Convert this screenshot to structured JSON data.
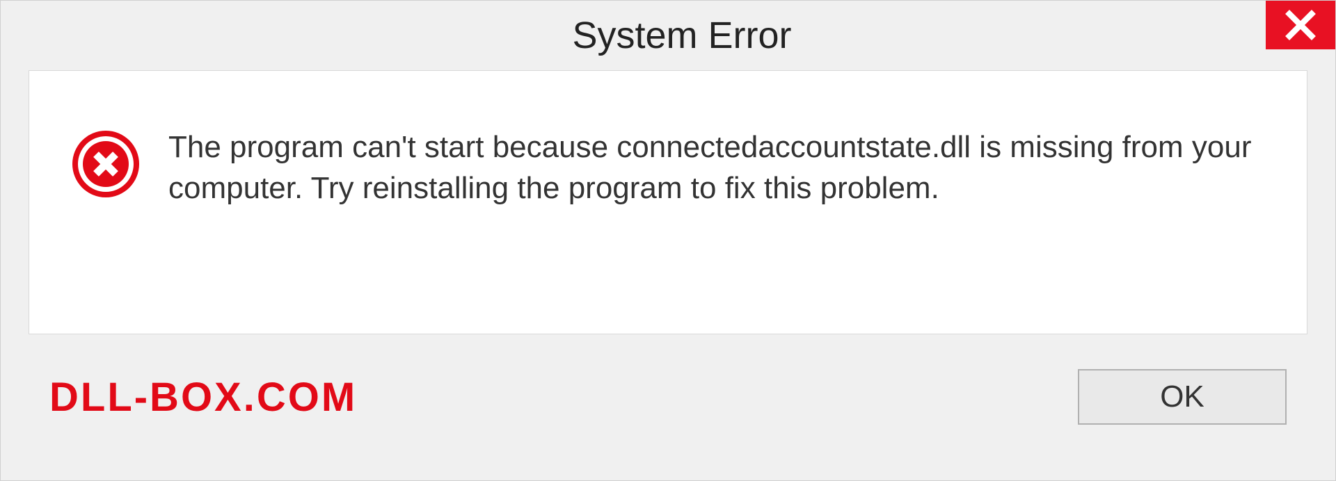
{
  "dialog": {
    "title": "System Error",
    "message": "The program can't start because connectedaccountstate.dll is missing from your computer. Try reinstalling the program to fix this problem.",
    "ok_label": "OK"
  },
  "brand": "DLL-BOX.COM",
  "colors": {
    "accent_red": "#e81123",
    "brand_red": "#e20a17"
  }
}
